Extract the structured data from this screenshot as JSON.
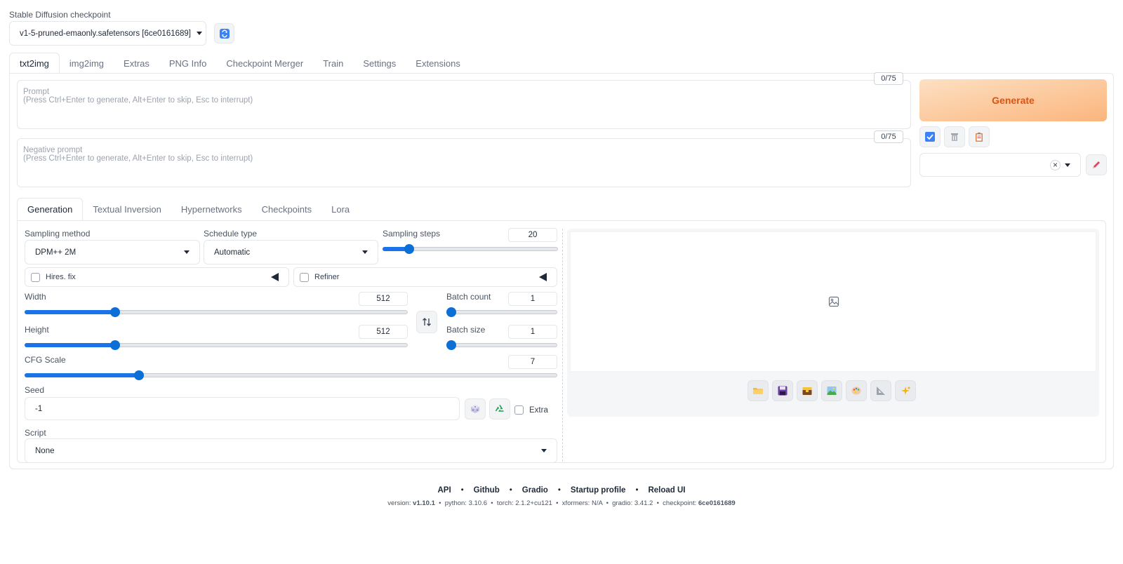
{
  "checkpoint": {
    "label": "Stable Diffusion checkpoint",
    "value": "v1-5-pruned-emaonly.safetensors [6ce0161689]",
    "refresh_icon": "refresh-icon"
  },
  "main_tabs": [
    "txt2img",
    "img2img",
    "Extras",
    "PNG Info",
    "Checkpoint Merger",
    "Train",
    "Settings",
    "Extensions"
  ],
  "prompt": {
    "placeholder_title": "Prompt",
    "placeholder_hint": "(Press Ctrl+Enter to generate, Alt+Enter to skip, Esc to interrupt)",
    "counter": "0/75"
  },
  "negative_prompt": {
    "placeholder_title": "Negative prompt",
    "placeholder_hint": "(Press Ctrl+Enter to generate, Alt+Enter to skip, Esc to interrupt)",
    "counter": "0/75"
  },
  "generate_label": "Generate",
  "style_tools": [
    "apply-styles-icon",
    "trash-icon",
    "clipboard-icon"
  ],
  "styles_select": {
    "value": "",
    "clear_icon": "×",
    "edit_icon": "pencil-icon"
  },
  "sub_tabs": [
    "Generation",
    "Textual Inversion",
    "Hypernetworks",
    "Checkpoints",
    "Lora"
  ],
  "generation": {
    "sampling_method": {
      "label": "Sampling method",
      "value": "DPM++ 2M"
    },
    "schedule_type": {
      "label": "Schedule type",
      "value": "Automatic"
    },
    "sampling_steps": {
      "label": "Sampling steps",
      "value": "20",
      "fraction": 0.13
    },
    "hires_fix": {
      "label": "Hires. fix"
    },
    "refiner": {
      "label": "Refiner"
    },
    "width": {
      "label": "Width",
      "value": "512",
      "fraction": 0.23
    },
    "height": {
      "label": "Height",
      "value": "512",
      "fraction": 0.23
    },
    "batch_count": {
      "label": "Batch count",
      "value": "1",
      "fraction": 0.0
    },
    "batch_size": {
      "label": "Batch size",
      "value": "1",
      "fraction": 0.0
    },
    "cfg_scale": {
      "label": "CFG Scale",
      "value": "7",
      "fraction": 0.21
    },
    "seed": {
      "label": "Seed",
      "value": "-1",
      "extra_label": "Extra"
    },
    "script": {
      "label": "Script",
      "value": "None"
    }
  },
  "gallery_tools": [
    "folder-icon",
    "save-icon",
    "zip-icon",
    "image-icon",
    "palette-icon",
    "ruler-icon",
    "sparkle-icon"
  ],
  "footer": {
    "links": [
      "API",
      "Github",
      "Gradio",
      "Startup profile",
      "Reload UI"
    ],
    "dot": "•",
    "version_label": "version:",
    "version": "v1.10.1",
    "python": "python: 3.10.6",
    "torch": "torch: 2.1.2+cu121",
    "xformers": "xformers: N/A",
    "gradio": "gradio: 3.41.2",
    "checkpoint_label": "checkpoint:",
    "checkpoint": "6ce0161689"
  },
  "colors": {
    "accent": "#1a73e8",
    "generate_text": "#e0520f",
    "generate_bg": "#fbb57d"
  }
}
